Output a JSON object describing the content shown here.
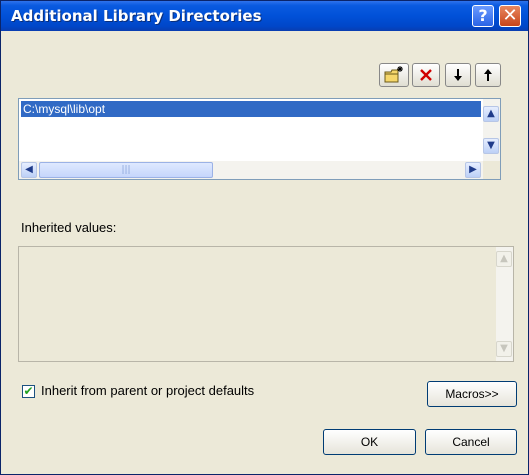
{
  "window": {
    "title": "Additional Library Directories",
    "help_glyph": "?",
    "close_glyph": "✕"
  },
  "toolbar": {
    "new_line_icon": "new-folder-icon",
    "delete_icon": "delete-icon",
    "move_down_icon": "arrow-down-icon",
    "move_up_icon": "arrow-up-icon"
  },
  "directories": {
    "items": [
      "C:\\mysql\\lib\\opt"
    ],
    "selected_index": 0
  },
  "inherited": {
    "label": "Inherited values:"
  },
  "options": {
    "inherit_checkbox_checked": true,
    "inherit_label": "Inherit from parent or project defaults"
  },
  "buttons": {
    "macros": "Macros>>",
    "ok": "OK",
    "cancel": "Cancel"
  },
  "colors": {
    "titlebar": "#0151d8",
    "selection": "#316ac5",
    "delete_icon": "#d00000",
    "check": "#21a121"
  }
}
